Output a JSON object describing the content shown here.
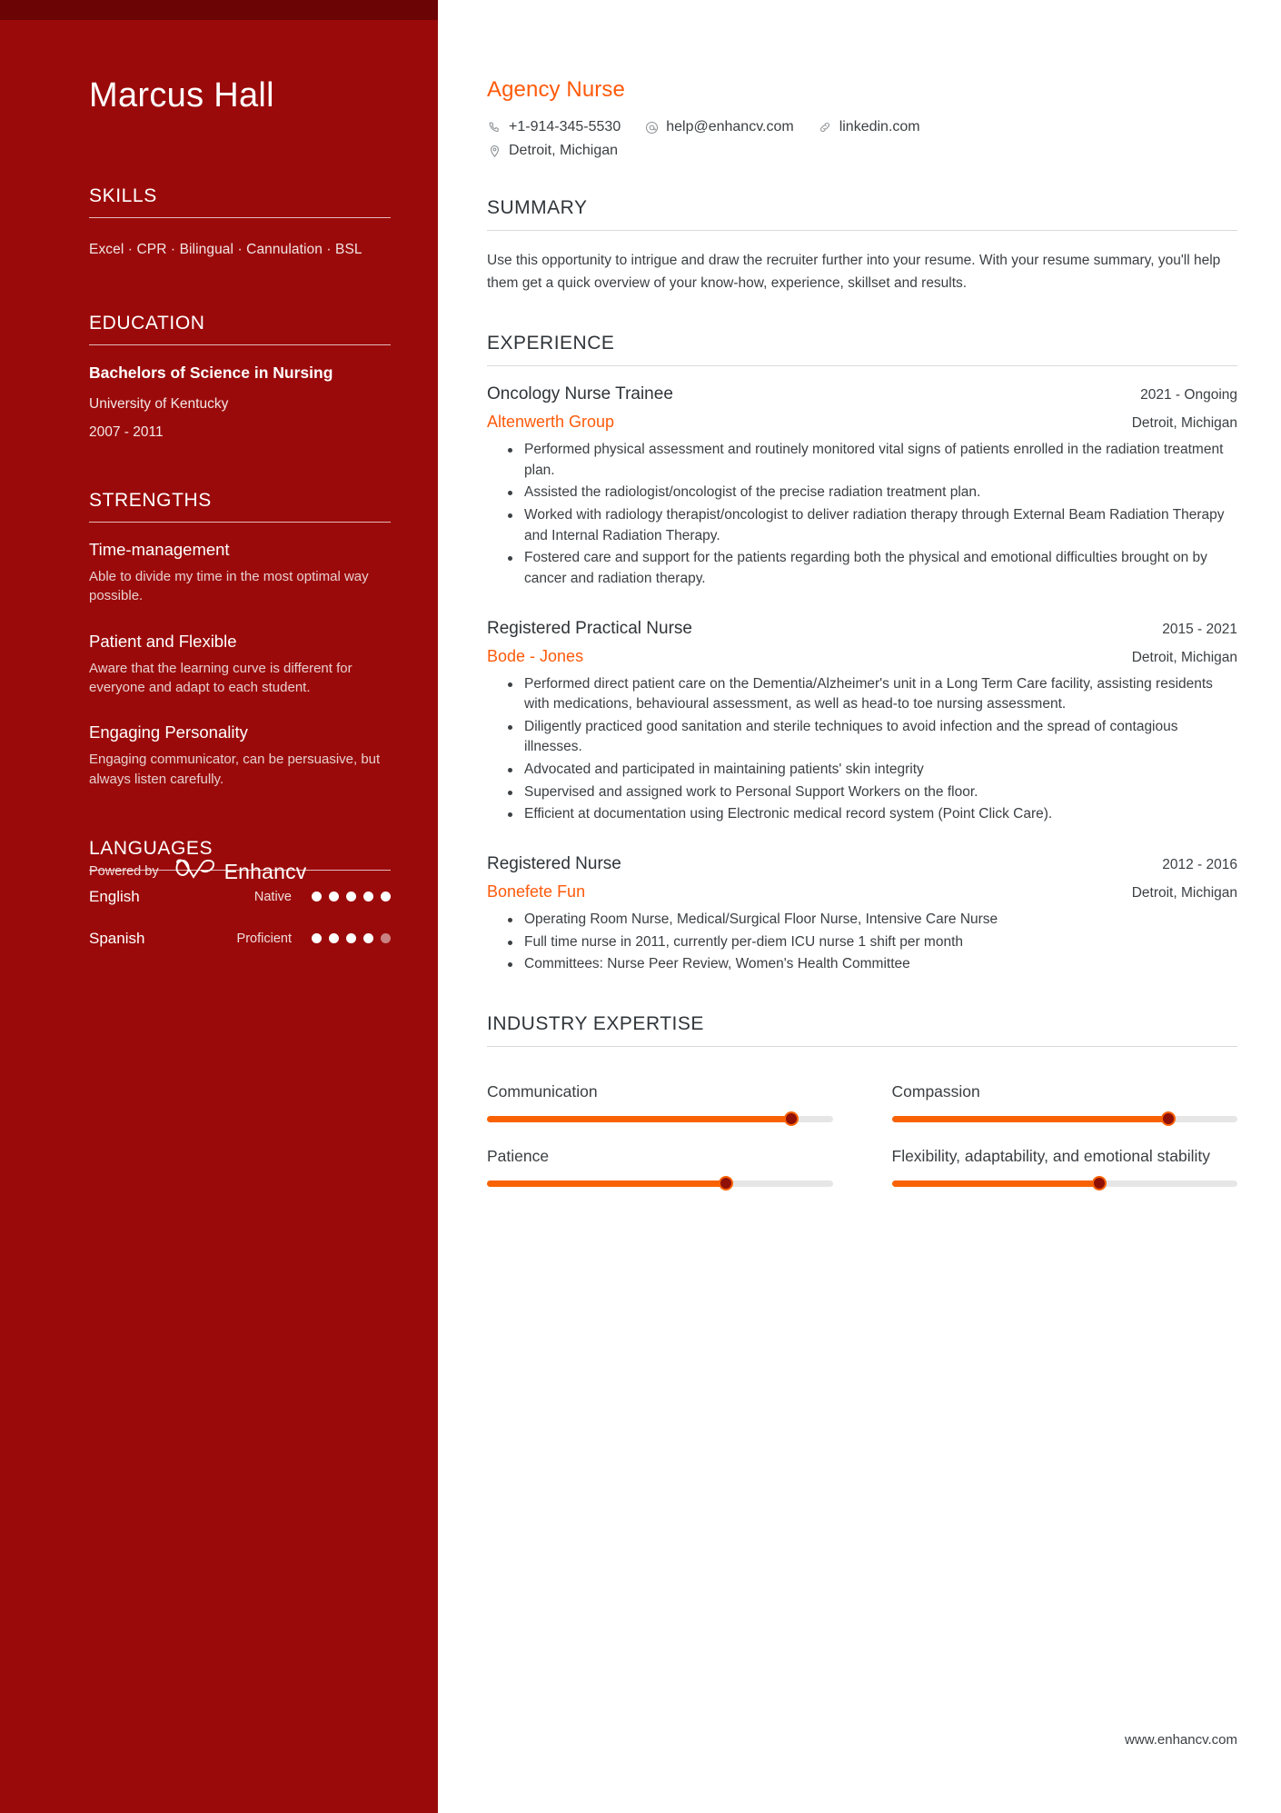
{
  "sidebar": {
    "name": "Marcus Hall",
    "skills": {
      "heading": "SKILLS",
      "text": "Excel · CPR · Bilingual · Cannulation · BSL"
    },
    "education": {
      "heading": "EDUCATION",
      "degree": "Bachelors of Science in Nursing",
      "school": "University of Kentucky",
      "dates": "2007 - 2011"
    },
    "strengths": {
      "heading": "STRENGTHS",
      "items": [
        {
          "title": "Time-management",
          "desc": "Able to divide my time in the most optimal way possible."
        },
        {
          "title": "Patient and Flexible",
          "desc": "Aware that the learning curve is different for everyone and adapt to each student."
        },
        {
          "title": "Engaging Personality",
          "desc": "Engaging communicator, can be persuasive, but always listen carefully."
        }
      ]
    },
    "languages": {
      "heading": "LANGUAGES",
      "items": [
        {
          "name": "English",
          "level": "Native",
          "filled": 5,
          "total": 5
        },
        {
          "name": "Spanish",
          "level": "Proficient",
          "filled": 4,
          "total": 5
        }
      ]
    },
    "footer": {
      "powered_label": "Powered by",
      "brand": "Enhancv"
    }
  },
  "main": {
    "job_title": "Agency Nurse",
    "contacts": [
      {
        "icon": "phone-icon",
        "text": "+1-914-345-5530"
      },
      {
        "icon": "email-icon",
        "text": "help@enhancv.com"
      },
      {
        "icon": "link-icon",
        "text": "linkedin.com"
      },
      {
        "icon": "location-icon",
        "text": "Detroit, Michigan"
      }
    ],
    "summary": {
      "heading": "SUMMARY",
      "text": "Use this opportunity to intrigue and draw the recruiter further into your resume. With your resume summary, you'll help them get a quick overview of your know-how, experience, skillset and results."
    },
    "experience": {
      "heading": "EXPERIENCE",
      "items": [
        {
          "role": "Oncology Nurse Trainee",
          "dates": "2021 - Ongoing",
          "company": "Altenwerth Group",
          "location": "Detroit, Michigan",
          "bullets": [
            "Performed physical assessment and routinely monitored vital signs of patients enrolled in the radiation treatment plan.",
            "Assisted the radiologist/oncologist of the precise radiation treatment plan.",
            "Worked with radiology therapist/oncologist to deliver radiation therapy through External Beam Radiation Therapy and Internal Radiation Therapy.",
            "Fostered care and support for the patients regarding both the physical and emotional difficulties brought on by cancer and radiation therapy."
          ]
        },
        {
          "role": "Registered Practical Nurse",
          "dates": "2015 - 2021",
          "company": "Bode - Jones",
          "location": "Detroit, Michigan",
          "bullets": [
            "Performed direct patient care on the Dementia/Alzheimer's unit in a Long Term Care facility, assisting residents with medications, behavioural assessment, as well as head-to toe nursing assessment.",
            "Diligently practiced good sanitation and sterile techniques to avoid infection and the spread of contagious illnesses.",
            "Advocated and participated in maintaining patients' skin integrity",
            "Supervised and assigned work to Personal Support Workers on the floor.",
            "Efficient at documentation using Electronic medical record system (Point Click Care)."
          ]
        },
        {
          "role": "Registered Nurse",
          "dates": "2012 - 2016",
          "company": "Bonefete Fun",
          "location": "Detroit, Michigan",
          "bullets": [
            "Operating Room Nurse, Medical/Surgical Floor Nurse, Intensive Care Nurse",
            "Full time nurse in 2011, currently per-diem ICU nurse 1 shift per month",
            "Committees: Nurse Peer Review, Women's Health Committee"
          ]
        }
      ]
    },
    "expertise": {
      "heading": "INDUSTRY EXPERTISE",
      "items": [
        {
          "label": "Communication",
          "value": 88
        },
        {
          "label": "Compassion",
          "value": 80
        },
        {
          "label": "Patience",
          "value": 69
        },
        {
          "label": "Flexibility, adaptability, and emotional stability",
          "value": 60
        }
      ]
    },
    "site_url": "www.enhancv.com"
  },
  "colors": {
    "sidebar_bg": "#9b0a0a",
    "sidebar_band": "#6b0505",
    "accent_orange": "#ff5a0a",
    "slider_fill": "#f96204",
    "slider_knob": "#8f1007",
    "text_dark": "#3c4043"
  }
}
